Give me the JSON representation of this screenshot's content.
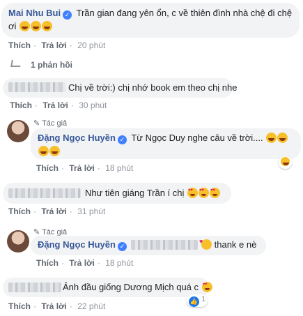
{
  "labels": {
    "like": "Thích",
    "reply": "Trả lời",
    "author_tag": "Tác giả",
    "replies_link": "1 phản hồi"
  },
  "comments": [
    {
      "name": "Mai Nhu Bui",
      "text_line1": "Trần gian đang yên ổn, c về thiên đình nhà chệ đi chệ",
      "text_line2": "ơi",
      "time": "20 phút"
    },
    {
      "text": "Chị về trời:) chị nhớ book em theo chị nhe",
      "time": "30 phút"
    },
    {
      "name": "Đặng Ngọc Huyền",
      "text_line1": "Từ Ngọc Duy nghe câu về trời....",
      "time": "18 phút"
    },
    {
      "text": "Như tiên giáng Trần í chị",
      "time": "31 phút"
    },
    {
      "name": "Đặng Ngọc Huyền",
      "text": "thank e nè",
      "time": "18 phút"
    },
    {
      "text": "Ảnh đầu giống Dương Mịch quá c",
      "time": "22 phút",
      "reaction_count": "1"
    }
  ],
  "colors": {
    "bubble": "#f2f3f5",
    "name": "#385898",
    "verified": "#4080ff",
    "link": "#606770",
    "meta": "#90949c"
  },
  "icons": {
    "laugh": "laughing-emoji-icon",
    "heart_eyes": "heart-eyes-emoji-icon",
    "kiss": "heart-kiss-emoji-icon",
    "pencil": "pencil-icon",
    "like": "like-thumb-icon"
  }
}
